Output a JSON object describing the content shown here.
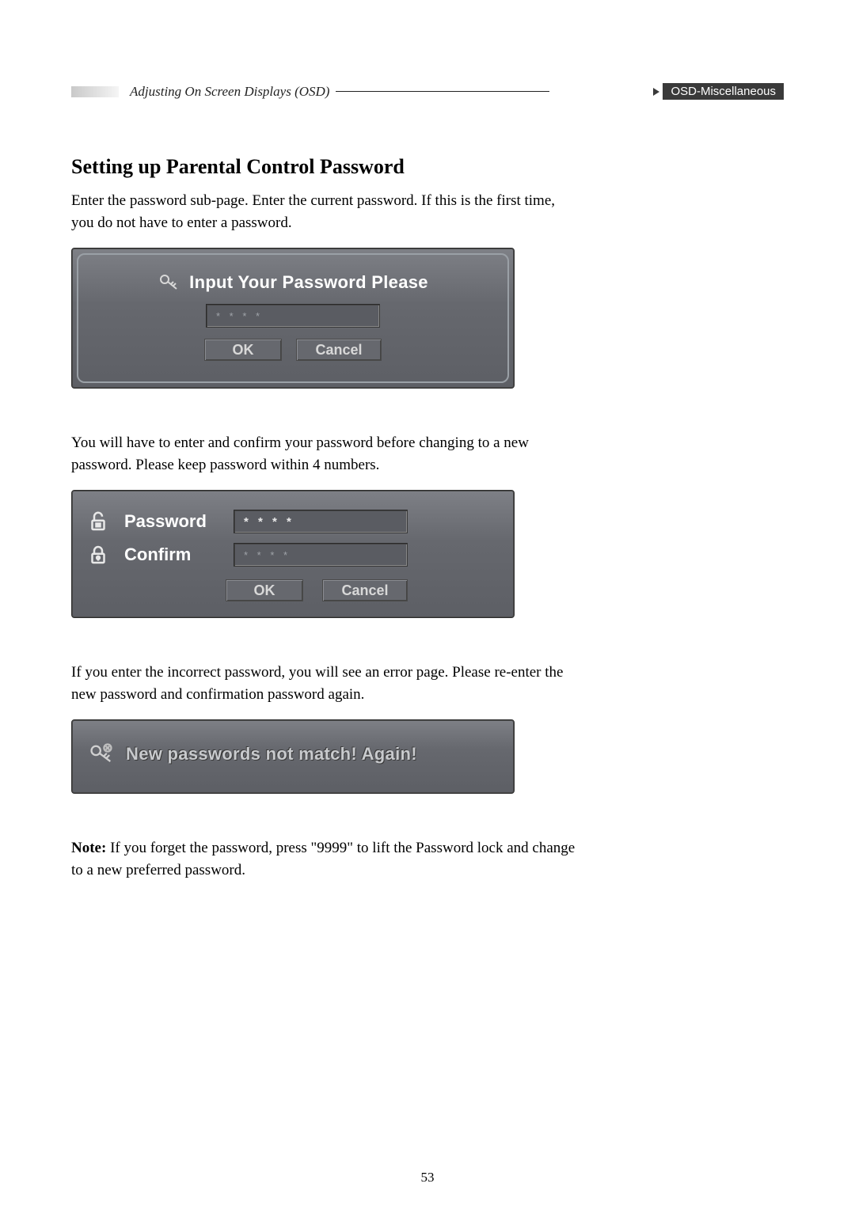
{
  "header": {
    "left": "Adjusting On Screen Displays (OSD)",
    "right": "OSD-Miscellaneous"
  },
  "title": "Setting up Parental Control Password",
  "para1": "Enter the password sub-page. Enter the current password. If this is the first time, you do not have to enter a password.",
  "osd1": {
    "title": "Input Your Password Please",
    "field_value": "* * * *",
    "ok": "OK",
    "cancel": "Cancel"
  },
  "para2": "You will have to enter and confirm your password before changing to a new password. Please keep password within 4 numbers.",
  "osd2": {
    "password_label": "Password",
    "confirm_label": "Confirm",
    "password_value": "* * * *",
    "confirm_value": "* * * *",
    "ok": "OK",
    "cancel": "Cancel"
  },
  "para3": "If you enter the incorrect password, you will see an error page. Please re-enter the new password and confirmation password again.",
  "osd3": {
    "message": "New passwords not match! Again!"
  },
  "note_label": "Note:",
  "note_text": " If you forget the password, press \"9999\" to lift the Password lock and change to a new preferred password.",
  "page_number": "53"
}
